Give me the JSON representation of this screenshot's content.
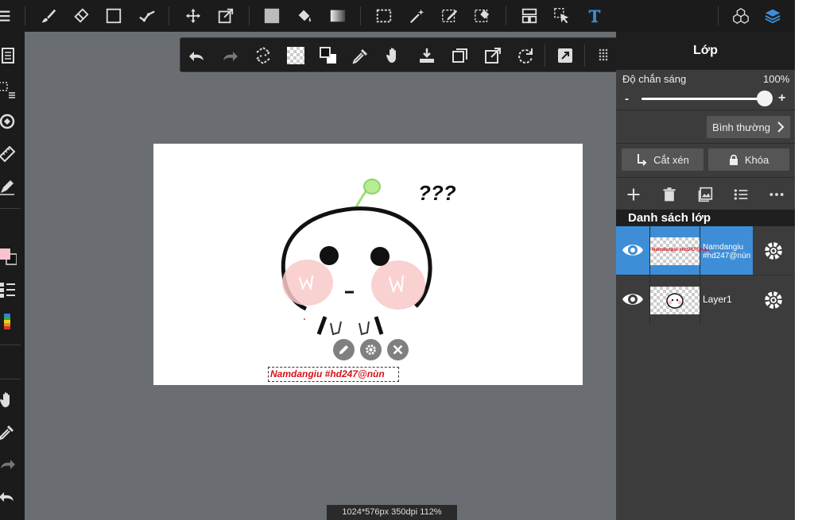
{
  "panel": {
    "title": "Lớp",
    "opacity_label": "Độ chắn sáng",
    "opacity_value": "100%",
    "slider_minus": "-",
    "slider_plus": "+",
    "blend_mode": "Bình thường",
    "clip_label": "Cắt xén",
    "lock_label": "Khóa",
    "list_header": "Danh sách lớp",
    "opacity_fraction": 1.0,
    "layers": [
      {
        "name": "Namdangiu #hd247@nùn",
        "name_line1": "Namdangiu",
        "name_line2": "#hd247@nùn",
        "thumb_text": "Namdangiu #hd247@nùn",
        "selected": true
      },
      {
        "name": "Layer1",
        "selected": false
      }
    ]
  },
  "canvas": {
    "text_layer": "Namdangiu #hd247@nùn",
    "question_marks": "???"
  },
  "status": {
    "info": "1024*576px 350dpi 112%"
  },
  "colors": {
    "accent": "#3d8ed6",
    "text_layer_color": "#d6101a",
    "fg_color": "#f7c3cf",
    "bg_color": "#000000"
  },
  "icons": {
    "top": [
      "menu-icon",
      "brush-icon",
      "eraser-icon",
      "rectangle-icon",
      "snap-ruler-icon",
      "move-icon",
      "transform-icon",
      "fill-rect-icon",
      "bucket-icon",
      "gradient-icon",
      "select-rect-icon",
      "magic-wand-icon",
      "select-pen-icon",
      "select-eraser-icon",
      "layout-icon",
      "select-arrow-icon",
      "text-tool-icon",
      "materials-icon",
      "layers-icon"
    ],
    "floating": [
      "undo-icon",
      "redo-icon",
      "transform-select-icon",
      "checker-icon",
      "color-swap-icon",
      "eyedropper-icon",
      "hand-icon",
      "save-icon",
      "duplicate-icon",
      "export-icon",
      "rotate-icon",
      "expand-icon",
      "grid-menu-icon"
    ]
  }
}
